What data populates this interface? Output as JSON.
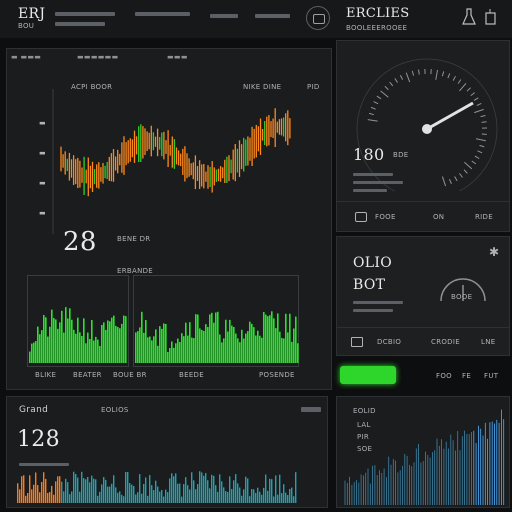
{
  "header": {
    "app_title": "ERJ",
    "app_subtitle": "BOU",
    "icon_right": "flask-icon"
  },
  "main_panel": {
    "title": "ACPI BOOR",
    "subtitle": "NIKE DINE",
    "value": "28",
    "value_label": "BENE DR",
    "value_sub": "ERBANDE",
    "corner_label": "PID",
    "chart_bottom_labels": [
      "BLIKE",
      "BEATER",
      "BOUE BR",
      "BEEDE",
      "POSENDE"
    ]
  },
  "gauge_panel": {
    "title": "ERCLIES",
    "subtitle": "BOOLEEEROOEE",
    "value": "180",
    "value_label": "BDE",
    "footer_labels": [
      "FOOE",
      "ON",
      "RIDE"
    ]
  },
  "mid_right_panel": {
    "value_a": "OLIO",
    "value_b": "BOT",
    "gauge_label": "BOOE",
    "footer_labels": [
      "DCBIO",
      "CRODIE",
      "LNE"
    ],
    "button_label": "",
    "small_labels": [
      "FOO",
      "FE",
      "FUT"
    ]
  },
  "bottom_left_panel": {
    "title": "Grand",
    "subtitle": "EOLIOS",
    "value": "128"
  },
  "bottom_right_panel": {
    "title": "EOLID",
    "labels": [
      "LAL",
      "PIR",
      "SOE"
    ]
  },
  "colors": {
    "orange": "#ff8a1c",
    "green": "#29e52a",
    "teal": "#1ea3b0",
    "accent_green_button": "#2ed52b"
  }
}
